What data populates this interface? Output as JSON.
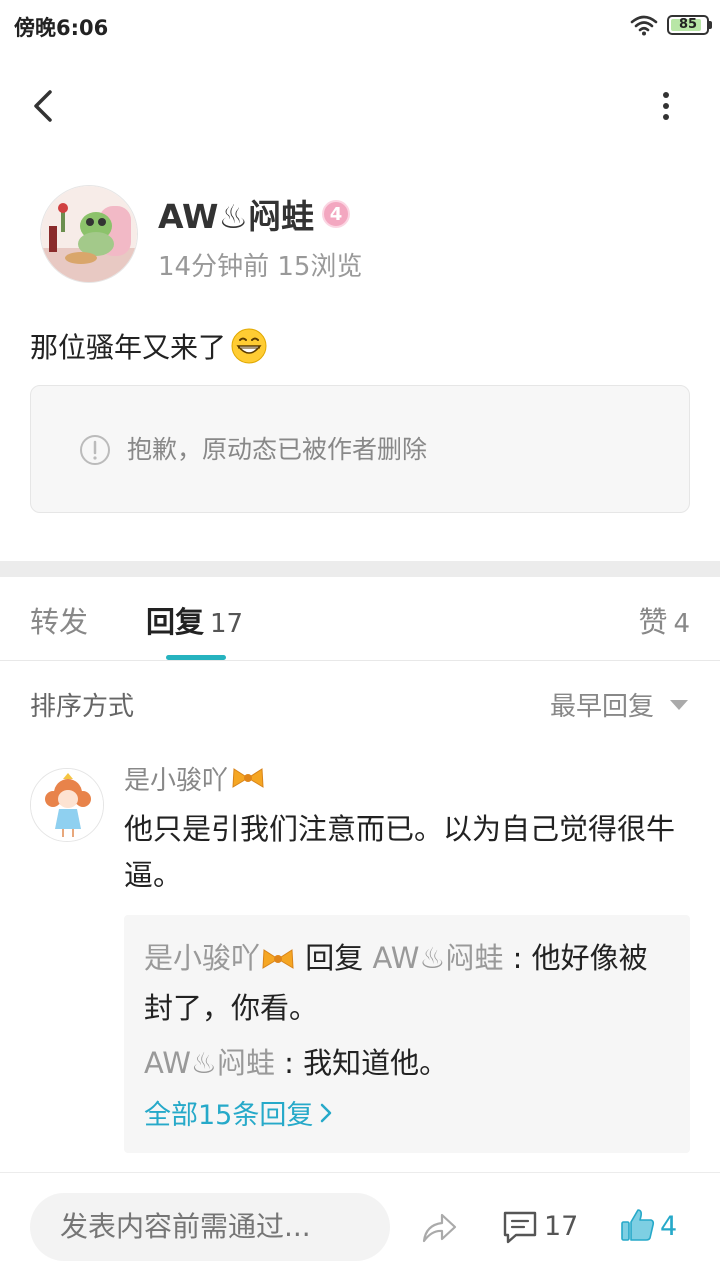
{
  "status_bar": {
    "time": "傍晚6:06",
    "battery": "85"
  },
  "post": {
    "author": "AW♨闷蛙",
    "level": "4",
    "meta": "14分钟前 15浏览",
    "text": "那位骚年又来了",
    "deleted_notice": "抱歉，原动态已被作者删除"
  },
  "tabs": {
    "forward": "转发",
    "reply": "回复",
    "reply_count": "17",
    "likes": "赞",
    "likes_count": "4"
  },
  "sort": {
    "label": "排序方式",
    "value": "最早回复"
  },
  "comment": {
    "user": "是小骏吖",
    "text": "他只是引我们注意而已。以为自己觉得很牛逼。",
    "replies": [
      {
        "user": "是小骏吖",
        "connector": "回复",
        "target": "AW♨闷蛙",
        "text": "他好像被封了，你看。"
      },
      {
        "user": "AW♨闷蛙",
        "text": "我知道他。"
      }
    ],
    "all_replies_link": "全部15条回复"
  },
  "bottom_bar": {
    "input_placeholder": "发表内容前需通过...",
    "comments_count": "17",
    "likes_count": "4"
  },
  "colors": {
    "accent": "#26b3bf",
    "link": "#26a9c9",
    "level_badge": "#f3a7c0"
  }
}
